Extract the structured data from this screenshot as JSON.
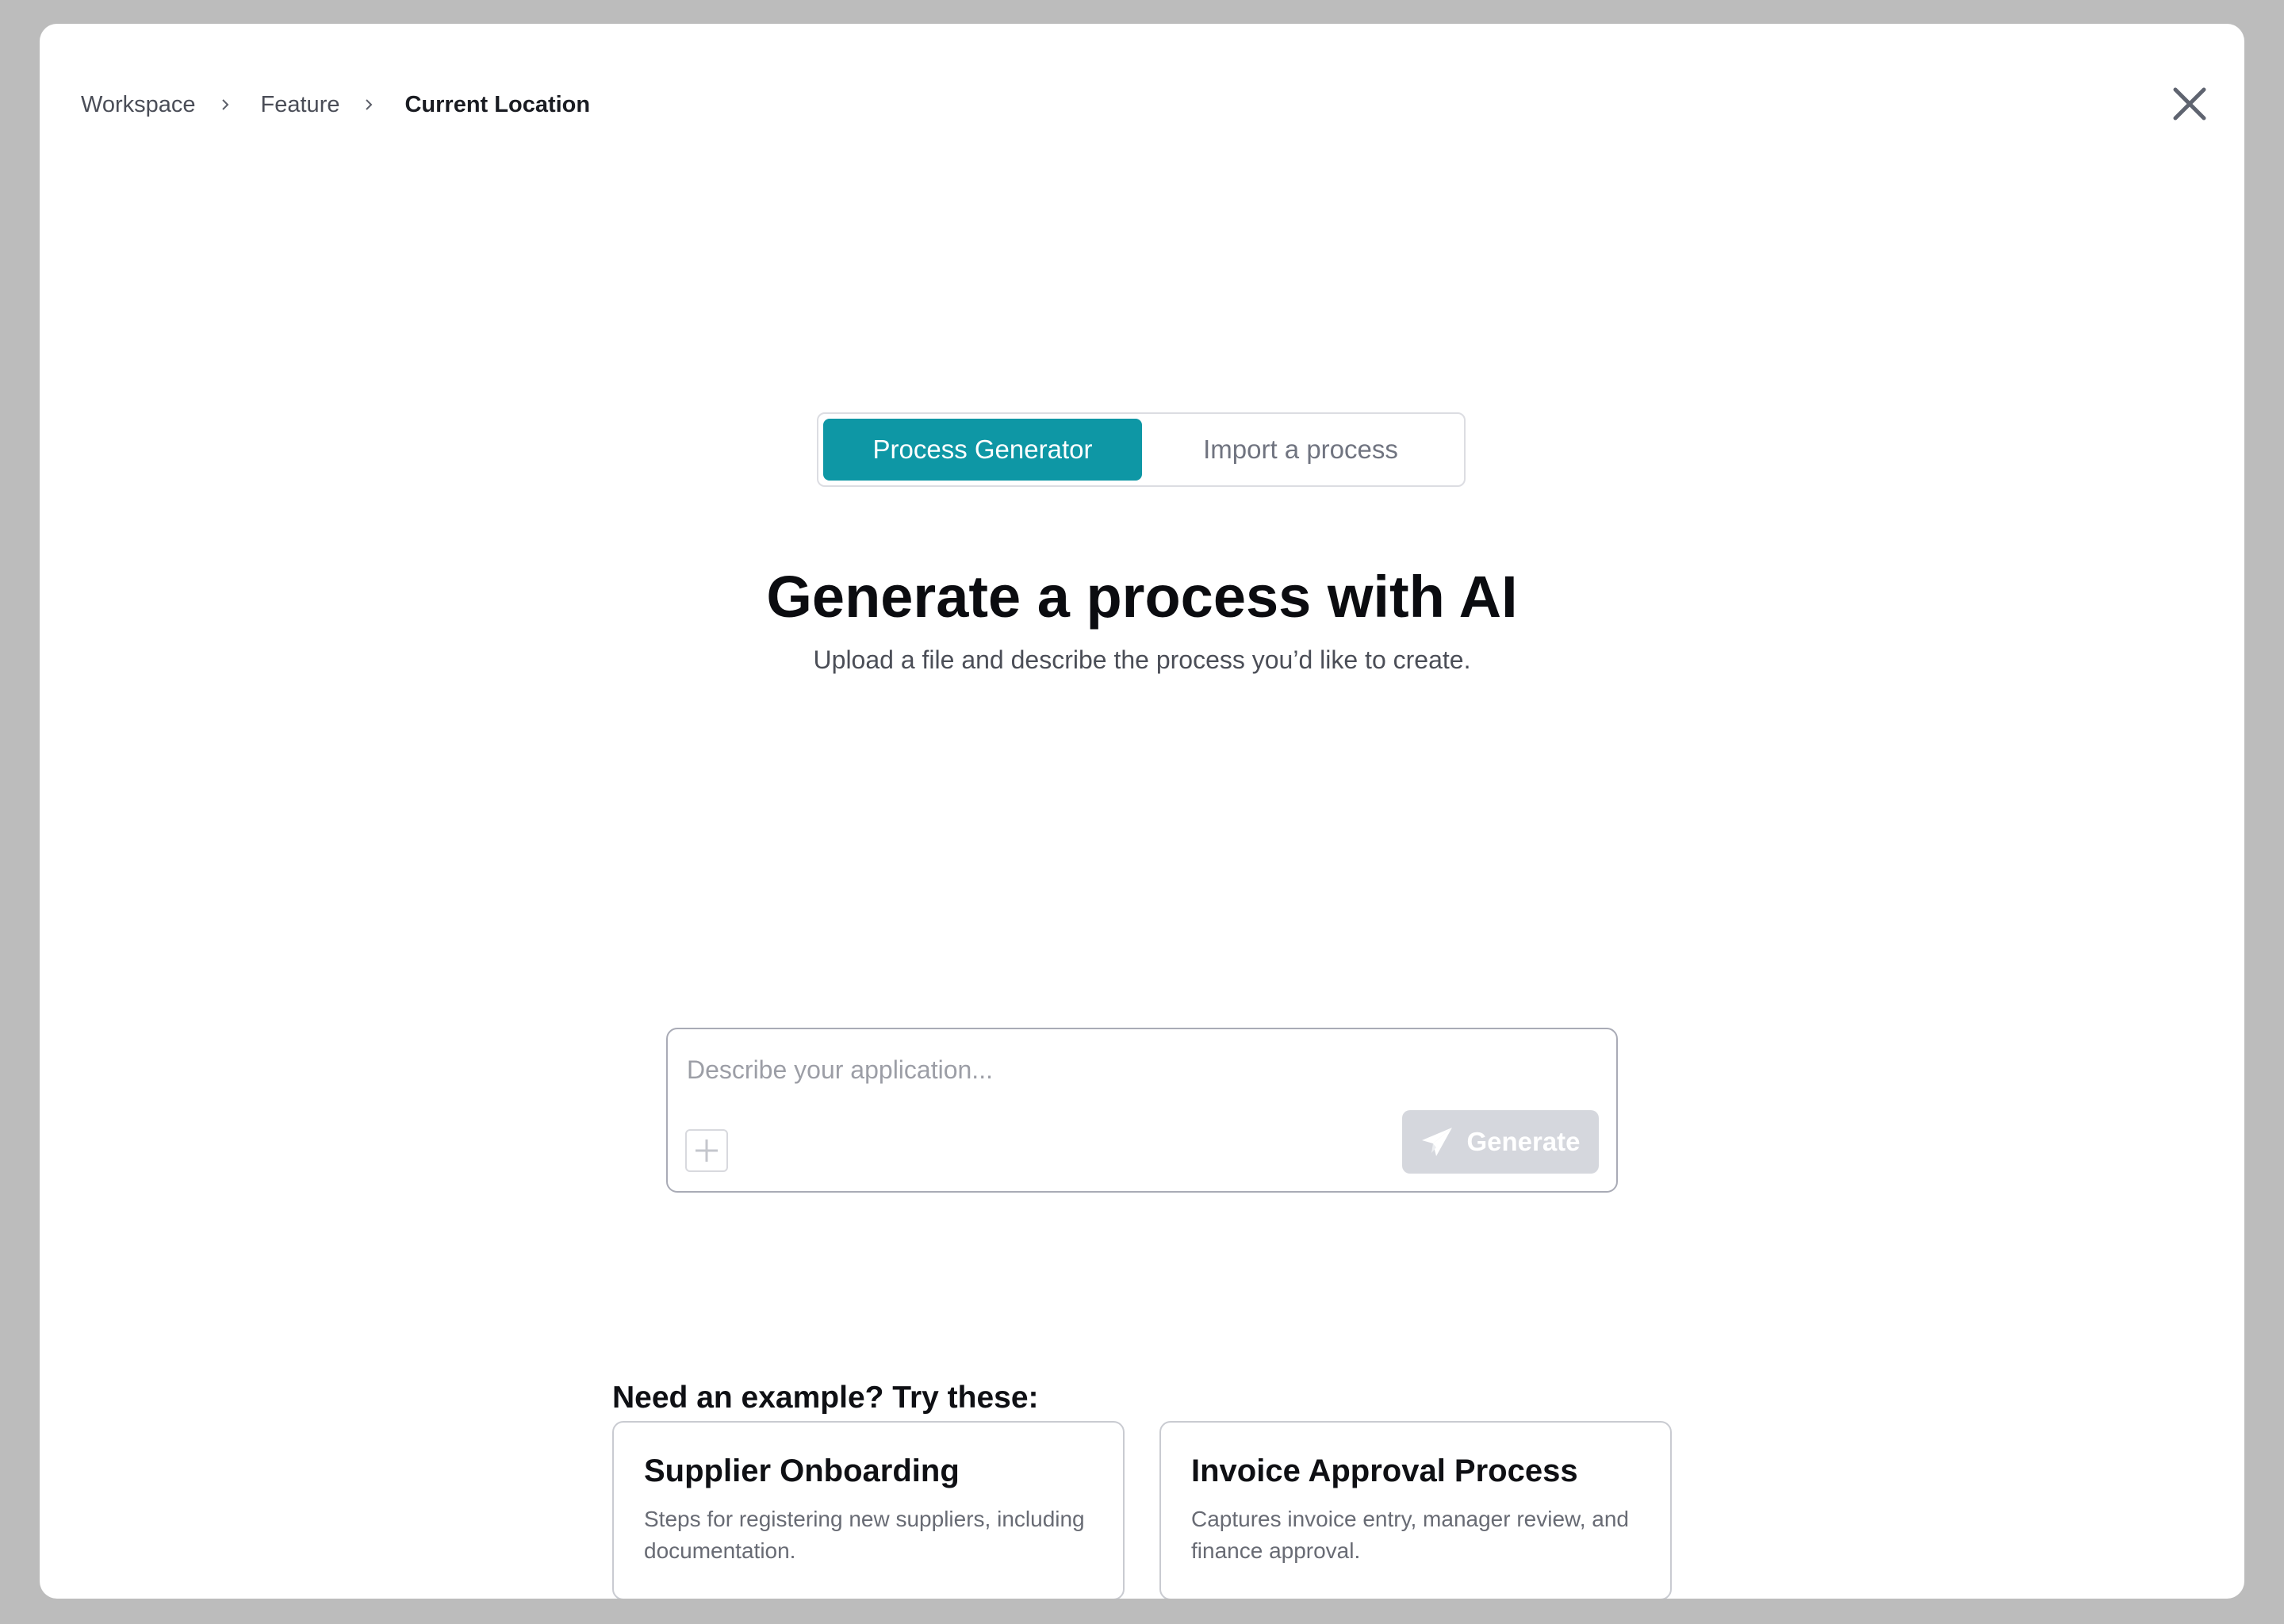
{
  "breadcrumb": {
    "items": [
      "Workspace",
      "Feature"
    ],
    "current": "Current Location"
  },
  "close": {
    "icon": "close-icon"
  },
  "tabs": [
    {
      "label": "Process Generator",
      "active": true
    },
    {
      "label": "Import a process",
      "active": false
    }
  ],
  "hero": {
    "title": "Generate a process with AI",
    "subtitle": "Upload a file and describe the process you’d like to create."
  },
  "prompt": {
    "value": "",
    "placeholder": "Describe your application...",
    "attach_icon": "plus-icon",
    "generate_label": "Generate",
    "generate_icon": "paper-plane-icon"
  },
  "examples": {
    "heading": "Need an example? Try these:",
    "cards": [
      {
        "title": "Supplier Onboarding",
        "description": "Steps for registering new suppliers, including documentation."
      },
      {
        "title": "Invoice Approval Process",
        "description": "Captures invoice entry, manager review, and finance approval."
      }
    ]
  },
  "colors": {
    "accent": "#0e97a5",
    "backdrop": "#bcbcbc",
    "disabled_button": "#d5d7dd"
  }
}
